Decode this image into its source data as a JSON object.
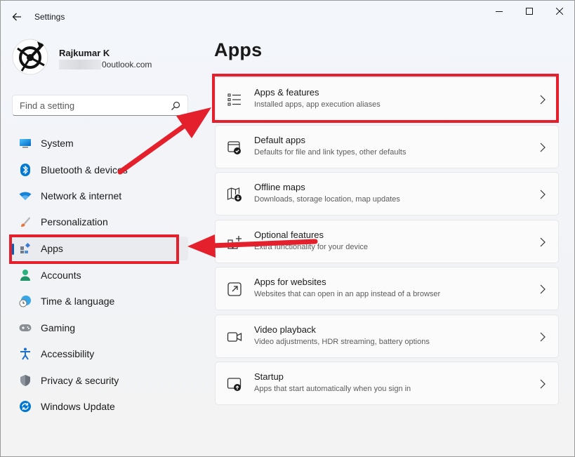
{
  "window": {
    "title": "Settings",
    "back_icon": "back-arrow-icon",
    "controls": [
      "minimize-icon",
      "maximize-icon",
      "close-icon"
    ]
  },
  "user": {
    "name": "Rajkumar K",
    "email_visible": "0outlook.com",
    "avatar_icon": "avatar-logo"
  },
  "search": {
    "placeholder": "Find a setting",
    "icon": "search-icon"
  },
  "sidebar": {
    "items": [
      {
        "label": "System",
        "icon": "system-icon"
      },
      {
        "label": "Bluetooth & devices",
        "icon": "bluetooth-icon"
      },
      {
        "label": "Network & internet",
        "icon": "wifi-icon"
      },
      {
        "label": "Personalization",
        "icon": "brush-icon"
      },
      {
        "label": "Apps",
        "icon": "apps-icon",
        "active": true
      },
      {
        "label": "Accounts",
        "icon": "accounts-icon"
      },
      {
        "label": "Time & language",
        "icon": "clock-globe-icon"
      },
      {
        "label": "Gaming",
        "icon": "gamepad-icon"
      },
      {
        "label": "Accessibility",
        "icon": "accessibility-icon"
      },
      {
        "label": "Privacy & security",
        "icon": "shield-icon"
      },
      {
        "label": "Windows Update",
        "icon": "update-icon"
      }
    ]
  },
  "main": {
    "title": "Apps",
    "cards": [
      {
        "title": "Apps & features",
        "desc": "Installed apps, app execution aliases",
        "icon": "list-icon"
      },
      {
        "title": "Default apps",
        "desc": "Defaults for file and link types, other defaults",
        "icon": "default-apps-icon"
      },
      {
        "title": "Offline maps",
        "desc": "Downloads, storage location, map updates",
        "icon": "map-download-icon"
      },
      {
        "title": "Optional features",
        "desc": "Extra functionality for your device",
        "icon": "optional-features-icon"
      },
      {
        "title": "Apps for websites",
        "desc": "Websites that can open in an app instead of a browser",
        "icon": "open-external-icon"
      },
      {
        "title": "Video playback",
        "desc": "Video adjustments, HDR streaming, battery options",
        "icon": "video-camera-icon"
      },
      {
        "title": "Startup",
        "desc": "Apps that start automatically when you sign in",
        "icon": "startup-icon"
      }
    ]
  },
  "annotation_color": "#e3202b",
  "accent_color": "#005fb8"
}
